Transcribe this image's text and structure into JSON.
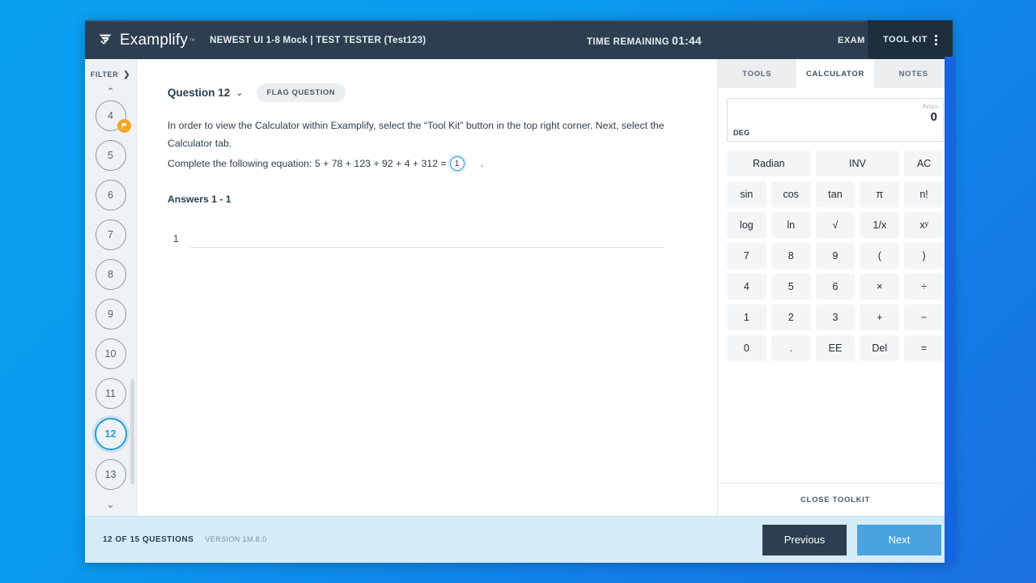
{
  "topbar": {
    "brand": "Examplify",
    "brand_tm": "™",
    "exam_title": "NEWEST UI 1-8 Mock | TEST TESTER (Test123)",
    "time_label": "TIME REMAINING",
    "time_value": "01:44",
    "exam_controls": "EXAM CONTROLS",
    "exam_controls_chevron": "⌄",
    "toolkit_label": "TOOL KIT",
    "bg_color": "#2c3e50"
  },
  "sidebar": {
    "filter_label": "FILTER",
    "filter_arrow": "❯",
    "caret_up": "⌃",
    "caret_down": "⌄",
    "items": [
      {
        "label": "4",
        "state": "flagged"
      },
      {
        "label": "5",
        "state": "normal"
      },
      {
        "label": "6",
        "state": "normal"
      },
      {
        "label": "7",
        "state": "normal"
      },
      {
        "label": "8",
        "state": "normal"
      },
      {
        "label": "9",
        "state": "normal"
      },
      {
        "label": "10",
        "state": "normal"
      },
      {
        "label": "11",
        "state": "normal"
      },
      {
        "label": "12",
        "state": "active"
      },
      {
        "label": "13",
        "state": "normal"
      }
    ]
  },
  "question": {
    "title": "Question 12",
    "title_chevron": "⌄",
    "flag_button": "FLAG QUESTION",
    "line1": "In order to view the Calculator within Examplify, select the “Tool Kit” button in the top right corner. Next, select the Calculator tab.",
    "line2_prefix": "Complete the following equation: 5 + 78 + 123 + 92 + 4 + 312 =",
    "blank_number": "1",
    "line2_suffix": ".",
    "answers_label": "Answers 1 - 1",
    "answer_rows": [
      {
        "num": "1",
        "value": ""
      }
    ]
  },
  "toolkit": {
    "tabs": [
      {
        "label": "TOOLS",
        "active": false
      },
      {
        "label": "CALCULATOR",
        "active": true
      },
      {
        "label": "NOTES",
        "active": false
      }
    ],
    "calculator": {
      "ans_label": "Ans=",
      "value": "0",
      "mode": "DEG",
      "keys": [
        {
          "label": "Radian",
          "span": 2
        },
        {
          "label": "INV",
          "span": 2
        },
        {
          "label": "AC",
          "span": 1
        },
        {
          "label": "sin",
          "span": 1
        },
        {
          "label": "cos",
          "span": 1
        },
        {
          "label": "tan",
          "span": 1
        },
        {
          "label": "π",
          "span": 1
        },
        {
          "label": "n!",
          "span": 1
        },
        {
          "label": "log",
          "span": 1
        },
        {
          "label": "ln",
          "span": 1
        },
        {
          "label": "√",
          "span": 1
        },
        {
          "label": "1/x",
          "span": 1
        },
        {
          "label": "xʸ",
          "span": 1
        },
        {
          "label": "7",
          "span": 1
        },
        {
          "label": "8",
          "span": 1
        },
        {
          "label": "9",
          "span": 1
        },
        {
          "label": "(",
          "span": 1
        },
        {
          "label": ")",
          "span": 1
        },
        {
          "label": "4",
          "span": 1
        },
        {
          "label": "5",
          "span": 1
        },
        {
          "label": "6",
          "span": 1
        },
        {
          "label": "×",
          "span": 1
        },
        {
          "label": "÷",
          "span": 1
        },
        {
          "label": "1",
          "span": 1
        },
        {
          "label": "2",
          "span": 1
        },
        {
          "label": "3",
          "span": 1
        },
        {
          "label": "+",
          "span": 1
        },
        {
          "label": "−",
          "span": 1
        },
        {
          "label": "0",
          "span": 1
        },
        {
          "label": ".",
          "span": 1
        },
        {
          "label": "EE",
          "span": 1
        },
        {
          "label": "Del",
          "span": 1
        },
        {
          "label": "=",
          "span": 1
        }
      ]
    },
    "close_label": "CLOSE TOOLKIT"
  },
  "footer": {
    "question_count": "12 OF 15 QUESTIONS",
    "version": "VERSION 1M.8.0",
    "previous_label": "Previous",
    "next_label": "Next",
    "previous_color": "#2c3e50",
    "next_color": "#4aa3df",
    "bg_color": "#d5ecf8"
  }
}
